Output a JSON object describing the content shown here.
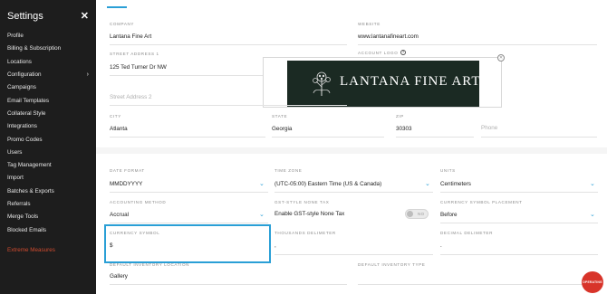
{
  "sidebar": {
    "title": "Settings",
    "close_icon": "close-icon",
    "items": [
      {
        "label": "Profile"
      },
      {
        "label": "Billing & Subscription"
      },
      {
        "label": "Locations"
      },
      {
        "label": "Configuration"
      },
      {
        "label": "Campaigns"
      },
      {
        "label": "Email Templates"
      },
      {
        "label": "Collateral Style"
      },
      {
        "label": "Integrations"
      },
      {
        "label": "Promo Codes"
      },
      {
        "label": "Users"
      },
      {
        "label": "Tag Management"
      },
      {
        "label": "Import"
      },
      {
        "label": "Batches & Exports"
      },
      {
        "label": "Referrals"
      },
      {
        "label": "Merge Tools"
      },
      {
        "label": "Blocked Emails"
      },
      {
        "label": "Extreme Measures"
      }
    ]
  },
  "company": {
    "label": "COMPANY",
    "value": "Lantana Fine Art"
  },
  "website": {
    "label": "WEBSITE",
    "value": "www.lantanafineart.com"
  },
  "street1": {
    "label": "STREET ADDRESS 1",
    "value": "125 Ted Turner Dr NW"
  },
  "account_logo": {
    "label": "ACCOUNT LOGO",
    "logo_text": "LANTANA FINE ART"
  },
  "street2": {
    "placeholder": "Street Address 2"
  },
  "city": {
    "label": "CITY",
    "value": "Atlanta"
  },
  "state": {
    "label": "STATE",
    "value": "Georgia"
  },
  "zip": {
    "label": "ZIP",
    "value": "30303"
  },
  "phone": {
    "placeholder": "Phone"
  },
  "date_format": {
    "label": "DATE FORMAT",
    "value": "MMDDYYYY"
  },
  "time_zone": {
    "label": "TIME ZONE",
    "value": "(UTC-05:00) Eastern Time (US & Canada)"
  },
  "units": {
    "label": "UNITS",
    "value": "Centimeters"
  },
  "accounting_method": {
    "label": "ACCOUNTING METHOD",
    "value": "Accrual"
  },
  "gst_tax": {
    "label": "GST-STYLE NONE TAX",
    "value": "Enable GST-style None Tax",
    "toggle_text": "NO",
    "enabled": false
  },
  "currency_placement": {
    "label": "CURRENCY SYMBOL PLACEMENT",
    "value": "Before"
  },
  "currency_symbol": {
    "label": "CURRENCY SYMBOL",
    "value": "$"
  },
  "thousands_delimeter": {
    "label": "THOUSANDS DELIMETER",
    "value": ","
  },
  "decimal_delimeter": {
    "label": "DECIMAL DELIMETER",
    "value": "."
  },
  "default_inventory_location": {
    "label": "DEFAULT INVENTORY LOCATION",
    "value": "Gallery"
  },
  "default_inventory_type": {
    "label": "DEFAULT INVENTORY TYPE",
    "value": ""
  },
  "badge": {
    "text": "OPERATING"
  },
  "colors": {
    "sidebar": "#1d1d1d",
    "accent": "#2a9fd6",
    "danger": "#d04b2f",
    "badge": "#d8342a"
  }
}
